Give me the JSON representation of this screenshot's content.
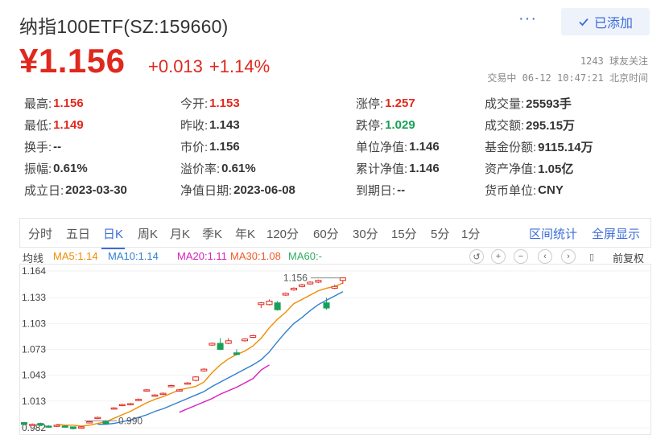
{
  "header": {
    "title": "纳指100ETF(SZ:159660)",
    "more": "···",
    "added_label": "已添加"
  },
  "quote": {
    "price": "¥1.156",
    "change": "+0.013",
    "change_pct": "+1.14%",
    "followers": "1243 球友关注",
    "status": "交易中 06-12 10:47:21 北京时间"
  },
  "colors": {
    "up": "#e0281e",
    "down": "#18a058",
    "accent": "#3c6cd8"
  },
  "stats": [
    [
      {
        "label": "最高:",
        "value": "1.156",
        "tone": "red"
      },
      {
        "label": "今开:",
        "value": "1.153",
        "tone": "red"
      },
      {
        "label": "涨停:",
        "value": "1.257",
        "tone": "red"
      },
      {
        "label": "成交量:",
        "value": "25593手",
        "tone": ""
      }
    ],
    [
      {
        "label": "最低:",
        "value": "1.149",
        "tone": "red"
      },
      {
        "label": "昨收:",
        "value": "1.143",
        "tone": ""
      },
      {
        "label": "跌停:",
        "value": "1.029",
        "tone": "green"
      },
      {
        "label": "成交额:",
        "value": "295.15万",
        "tone": ""
      }
    ],
    [
      {
        "label": "换手:",
        "value": "--",
        "tone": ""
      },
      {
        "label": "市价:",
        "value": "1.156",
        "tone": ""
      },
      {
        "label": "单位净值:",
        "value": "1.146",
        "tone": ""
      },
      {
        "label": "基金份额:",
        "value": "9115.14万",
        "tone": ""
      }
    ],
    [
      {
        "label": "振幅:",
        "value": "0.61%",
        "tone": ""
      },
      {
        "label": "溢价率:",
        "value": "0.61%",
        "tone": ""
      },
      {
        "label": "累计净值:",
        "value": "1.146",
        "tone": ""
      },
      {
        "label": "资产净值:",
        "value": "1.05亿",
        "tone": ""
      }
    ],
    [
      {
        "label": "成立日:",
        "value": "2023-03-30",
        "tone": ""
      },
      {
        "label": "净值日期:",
        "value": "2023-06-08",
        "tone": ""
      },
      {
        "label": "到期日:",
        "value": "--",
        "tone": ""
      },
      {
        "label": "货币单位:",
        "value": "CNY",
        "tone": ""
      }
    ]
  ],
  "tabs": {
    "items": [
      "分时",
      "五日",
      "日K",
      "周K",
      "月K",
      "季K",
      "年K",
      "120分",
      "60分",
      "30分",
      "15分",
      "5分",
      "1分"
    ],
    "active": "日K",
    "range_stats": "区间统计",
    "fullscreen": "全屏显示"
  },
  "ma_legend": {
    "label": "均线",
    "items": [
      {
        "text": "MA5:1.14",
        "color": "#f08c00"
      },
      {
        "text": "MA10:1.14",
        "color": "#2f7fd0"
      },
      {
        "text": "MA20:1.11",
        "color": "#d91ebc"
      },
      {
        "text": "MA30:1.08",
        "color": "#f05a28"
      },
      {
        "text": "MA60:-",
        "color": "#2fae5f"
      }
    ],
    "adjust": "前复权"
  },
  "chart_data": {
    "type": "candlestick",
    "y_ticks": [
      "1.164",
      "1.133",
      "1.103",
      "1.073",
      "1.043",
      "1.013",
      "0.982"
    ],
    "ylim": [
      0.982,
      1.164
    ],
    "max_label": "1.156",
    "min_label": "0.990",
    "candles": [
      {
        "o": 0.988,
        "c": 0.986,
        "h": 0.989,
        "l": 0.985
      },
      {
        "o": 0.986,
        "c": 0.986,
        "h": 0.987,
        "l": 0.985
      },
      {
        "o": 0.987,
        "c": 0.985,
        "h": 0.988,
        "l": 0.984
      },
      {
        "o": 0.984,
        "c": 0.983,
        "h": 0.985,
        "l": 0.982
      },
      {
        "o": 0.984,
        "c": 0.985,
        "h": 0.986,
        "l": 0.983
      },
      {
        "o": 0.984,
        "c": 0.983,
        "h": 0.985,
        "l": 0.983
      },
      {
        "o": 0.983,
        "c": 0.981,
        "h": 0.983,
        "l": 0.98
      },
      {
        "o": 0.982,
        "c": 0.983,
        "h": 0.984,
        "l": 0.981
      },
      {
        "o": 0.988,
        "c": 0.989,
        "h": 0.99,
        "l": 0.987
      },
      {
        "o": 0.993,
        "c": 0.994,
        "h": 0.995,
        "l": 0.992
      },
      {
        "o": 0.99,
        "c": 0.987,
        "h": 0.991,
        "l": 0.986
      },
      {
        "o": 1.004,
        "c": 1.005,
        "h": 1.006,
        "l": 1.003
      },
      {
        "o": 1.008,
        "c": 1.009,
        "h": 1.01,
        "l": 1.007
      },
      {
        "o": 1.009,
        "c": 1.01,
        "h": 1.011,
        "l": 1.008
      },
      {
        "o": 1.014,
        "c": 1.015,
        "h": 1.016,
        "l": 1.013
      },
      {
        "o": 1.025,
        "c": 1.026,
        "h": 1.027,
        "l": 1.024
      },
      {
        "o": 1.019,
        "c": 1.02,
        "h": 1.021,
        "l": 1.018
      },
      {
        "o": 1.021,
        "c": 1.022,
        "h": 1.023,
        "l": 1.02
      },
      {
        "o": 1.03,
        "c": 1.031,
        "h": 1.032,
        "l": 1.029
      },
      {
        "o": 1.025,
        "c": 1.026,
        "h": 1.027,
        "l": 1.024
      },
      {
        "o": 1.033,
        "c": 1.034,
        "h": 1.035,
        "l": 1.032
      },
      {
        "o": 1.037,
        "c": 1.041,
        "h": 1.042,
        "l": 1.036
      },
      {
        "o": 1.048,
        "c": 1.05,
        "h": 1.051,
        "l": 1.047
      },
      {
        "o": 1.078,
        "c": 1.08,
        "h": 1.081,
        "l": 1.077
      },
      {
        "o": 1.08,
        "c": 1.073,
        "h": 1.086,
        "l": 1.072
      },
      {
        "o": 1.08,
        "c": 1.083,
        "h": 1.086,
        "l": 1.079
      },
      {
        "o": 1.069,
        "c": 1.067,
        "h": 1.073,
        "l": 1.066
      },
      {
        "o": 1.083,
        "c": 1.085,
        "h": 1.086,
        "l": 1.082
      },
      {
        "o": 1.087,
        "c": 1.089,
        "h": 1.09,
        "l": 1.086
      },
      {
        "o": 1.125,
        "c": 1.127,
        "h": 1.128,
        "l": 1.121
      },
      {
        "o": 1.125,
        "c": 1.129,
        "h": 1.131,
        "l": 1.124
      },
      {
        "o": 1.127,
        "c": 1.119,
        "h": 1.129,
        "l": 1.118
      },
      {
        "o": 1.136,
        "c": 1.138,
        "h": 1.139,
        "l": 1.135
      },
      {
        "o": 1.142,
        "c": 1.144,
        "h": 1.145,
        "l": 1.141
      },
      {
        "o": 1.146,
        "c": 1.148,
        "h": 1.149,
        "l": 1.145
      },
      {
        "o": 1.149,
        "c": 1.151,
        "h": 1.152,
        "l": 1.148
      },
      {
        "o": 1.151,
        "c": 1.153,
        "h": 1.154,
        "l": 1.15
      },
      {
        "o": 1.127,
        "c": 1.121,
        "h": 1.133,
        "l": 1.119
      },
      {
        "o": 1.144,
        "c": 1.146,
        "h": 1.148,
        "l": 1.143
      },
      {
        "o": 1.153,
        "c": 1.156,
        "h": 1.156,
        "l": 1.149
      }
    ],
    "ma5": [
      null,
      null,
      null,
      null,
      0.986,
      0.985,
      0.985,
      0.984,
      0.985,
      0.987,
      0.989,
      0.993,
      0.997,
      1.001,
      1.006,
      1.011,
      1.015,
      1.018,
      1.022,
      1.026,
      1.028,
      1.03,
      1.035,
      1.046,
      1.055,
      1.062,
      1.067,
      1.071,
      1.077,
      1.086,
      1.098,
      1.108,
      1.116,
      1.126,
      1.131,
      1.136,
      1.141,
      1.144,
      1.146,
      1.15
    ],
    "ma10": [
      null,
      null,
      null,
      null,
      null,
      null,
      null,
      null,
      null,
      0.986,
      0.986,
      0.987,
      0.989,
      0.991,
      0.994,
      0.997,
      1.001,
      1.004,
      1.008,
      1.012,
      1.016,
      1.02,
      1.024,
      1.03,
      1.035,
      1.04,
      1.045,
      1.05,
      1.055,
      1.061,
      1.07,
      1.082,
      1.093,
      1.103,
      1.11,
      1.118,
      1.125,
      1.13,
      1.135,
      1.14
    ],
    "ma20": [
      null,
      null,
      null,
      null,
      null,
      null,
      null,
      null,
      null,
      null,
      null,
      null,
      null,
      null,
      null,
      null,
      null,
      null,
      null,
      1.0,
      1.004,
      1.008,
      1.012,
      1.016,
      1.021,
      1.025,
      1.029,
      1.034,
      1.039,
      1.049,
      1.055,
      null,
      null,
      null,
      null,
      null,
      null,
      null,
      null,
      null
    ],
    "ma30": [],
    "ma60": []
  }
}
